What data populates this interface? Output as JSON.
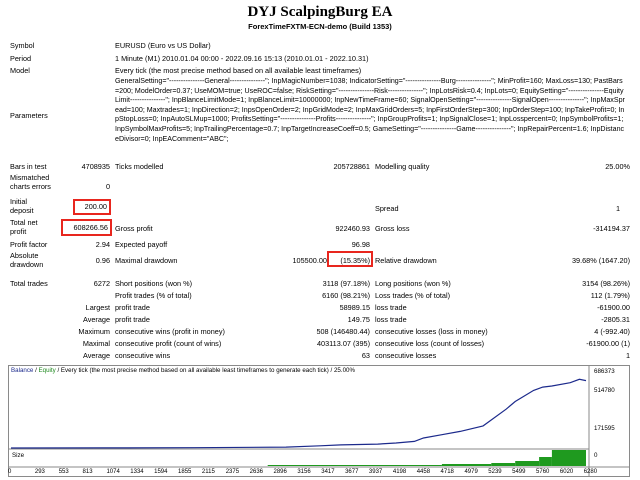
{
  "header": {
    "title": "DYJ ScalpingBurg EA",
    "subtitle": "ForexTimeFXTM-ECN-demo (Build 1353)"
  },
  "info": {
    "symbol_label": "Symbol",
    "symbol_value": "EURUSD (Euro vs US Dollar)",
    "period_label": "Period",
    "period_value": "1 Minute (M1) 2010.01.04 00:00 - 2022.09.16 15:13 (2010.01.01 - 2022.10.31)",
    "model_label": "Model",
    "model_value": "Every tick (the most precise method based on all available least timeframes)",
    "parameters_label": "Parameters",
    "parameters_value": "GeneralSetting=\"---------------General---------------\"; InpMagicNumber=1038; IndicatorSetting=\"---------------Burg---------------\"; MinProfit=160; MaxLoss=130; PastBars=200; ModelOrder=0.37; UseMOM=true; UseROC=false; RiskSetting=\"---------------Risk---------------\"; InpLotsRisk=0.4; InpLots=0; EquitySetting=\"---------------EquityLimit---------------\"; InpBlanceLimitMode=1; InpBlanceLimit=10000000; InpNewTimeFrame=60; SignalOpenSetting=\"---------------SignalOpen---------------\"; InpMaxSpread=100; Maxtrades=1; InpDirection=2; InpsOpenOrder=2; InpGridMode=2; InpMaxGridOrders=5; InpFirstOrderStep=300; InpOrderStep=100; InpTakeProfit=0; InpStopLoss=0; InpAutoSLMup=1000; ProfitsSetting=\"---------------Profits---------------\"; InpGroupProfits=1; InpSignalClose=1; InpLosspercent=0; InpSymbolProfits=1; InpSymbolMaxProfits=5; InpTrailingPercentage=0.7; InpTargetIncreaseCoeff=0.5; GameSetting=\"---------------Game---------------\"; InpRepairPercent=1.6; InpDistanceDivisor=0; InpEAComment=\"ABC\";"
  },
  "stats": {
    "bars_label": "Bars in test",
    "bars_value": "4708935",
    "ticks_label": "Ticks modelled",
    "ticks_value": "205728861",
    "mq_label": "Modelling quality",
    "mq_value": "25.00%",
    "mismatch_label_1": "Mismatched",
    "mismatch_label_2": "charts errors",
    "mismatch_value": "0",
    "deposit_label_1": "Initial",
    "deposit_label_2": "deposit",
    "deposit_value": "200.00",
    "spread_label": "Spread",
    "spread_value": "1",
    "netprofit_label_1": "Total net",
    "netprofit_label_2": "profit",
    "netprofit_value": "608266.56",
    "grossprofit_label": "Gross profit",
    "grossprofit_value": "922460.93",
    "grossloss_label": "Gross loss",
    "grossloss_value": "-314194.37",
    "pf_label": "Profit factor",
    "pf_value": "2.94",
    "ep_label": "Expected payoff",
    "ep_value": "96.98",
    "absdd_label_1": "Absolute",
    "absdd_label_2": "drawdown",
    "absdd_value": "0.96",
    "maxdd_label": "Maximal drawdown",
    "maxdd_value_a": "105500.00",
    "maxdd_value_b": "(15.35%)",
    "reldd_label": "Relative drawdown",
    "reldd_value": "39.68% (1647.20)",
    "tt_label": "Total trades",
    "tt_value": "6272",
    "short_label": "Short positions (won %)",
    "short_value": "3118 (97.18%)",
    "long_label": "Long positions (won %)",
    "long_value": "3154 (98.26%)",
    "pt_label": "Profit trades (% of total)",
    "pt_value": "6160 (98.21%)",
    "lt_label": "Loss trades (% of total)",
    "lt_value": "112 (1.79%)",
    "largest_label": "Largest",
    "largest_pt_label": "profit trade",
    "largest_pt_value": "58989.15",
    "largest_lt_label": "loss trade",
    "largest_lt_value": "-61900.00",
    "average_label": "Average",
    "avg_pt_label": "profit trade",
    "avg_pt_value": "149.75",
    "avg_lt_label": "loss trade",
    "avg_lt_value": "-2805.31",
    "maximum_label": "Maximum",
    "max_cw_label": "consecutive wins (profit in money)",
    "max_cw_value": "508 (146480.44)",
    "max_cl_label": "consecutive losses (loss in money)",
    "max_cl_value": "4 (-992.40)",
    "maximal_label": "Maximal",
    "maxl_cp_label": "consecutive profit (count of wins)",
    "maxl_cp_value": "403113.07 (395)",
    "maxl_cl_label": "consecutive loss (count of losses)",
    "maxl_cl_value": "-61900.00 (1)",
    "average2_label": "Average",
    "avg_cw_label": "consecutive wins",
    "avg_cw_value": "63",
    "avg_cl_label": "consecutive losses",
    "avg_cl_value": "1"
  },
  "chart_header": {
    "balance": "Balance",
    "sep1": " / ",
    "equity": "Equity",
    "rest": " / Every tick (the most precise method based on all available least timeframes to generate each tick) / 25.00%"
  },
  "chart_data": {
    "type": "line",
    "series": [
      {
        "name": "Balance",
        "x": [
          0,
          1000,
          2000,
          3000,
          3370,
          3600,
          4000,
          4200,
          4400,
          4500,
          4700,
          4900,
          5150,
          5400,
          5500,
          5700,
          5800,
          5900,
          6100,
          6200,
          6272
        ],
        "y": [
          200,
          1000,
          3000,
          8000,
          20000,
          28000,
          35000,
          45000,
          60000,
          90000,
          120000,
          150000,
          200000,
          350000,
          420000,
          520000,
          550000,
          560000,
          590000,
          620000,
          608266
        ]
      }
    ],
    "size_color": "#1f9a1f",
    "balance_color": "#1c2a8c",
    "x_ticks": [
      "0",
      "293",
      "553",
      "813",
      "1074",
      "1334",
      "1594",
      "1855",
      "2115",
      "2375",
      "2636",
      "2896",
      "3156",
      "3417",
      "3677",
      "3937",
      "4198",
      "4458",
      "4718",
      "4979",
      "5239",
      "5499",
      "5760",
      "6020",
      "6280"
    ],
    "y_ticks": [
      "686373",
      "514780",
      "171595",
      "0"
    ],
    "size_label": "Size"
  }
}
